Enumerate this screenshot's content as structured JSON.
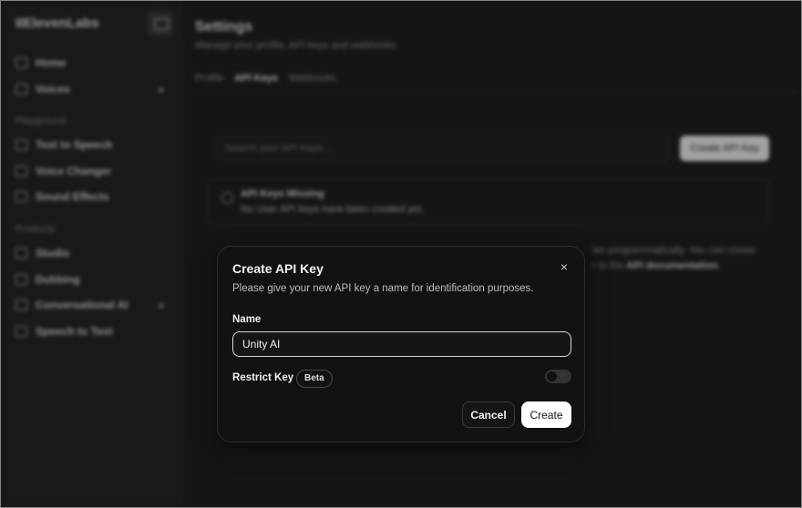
{
  "sidebar": {
    "logo": "IIElevenLabs",
    "items_top": [
      {
        "label": "Home",
        "icon": "home-icon"
      },
      {
        "label": "Voices",
        "icon": "voices-icon"
      }
    ],
    "section_playground": "Playground",
    "playground_items": [
      {
        "label": "Text to Speech",
        "icon": "text-to-speech-icon"
      },
      {
        "label": "Voice Changer",
        "icon": "voice-changer-icon"
      },
      {
        "label": "Sound Effects",
        "icon": "sound-effects-icon"
      }
    ],
    "section_products": "Products",
    "product_items": [
      {
        "label": "Studio",
        "icon": "studio-icon"
      },
      {
        "label": "Dubbing",
        "icon": "dubbing-icon"
      },
      {
        "label": "Conversational AI",
        "icon": "conversational-ai-icon"
      },
      {
        "label": "Speech to Text",
        "icon": "speech-to-text-icon"
      }
    ],
    "plus": "+"
  },
  "main": {
    "title": "Settings",
    "subtitle": "Manage your profile, API keys and webhooks.",
    "tabs": [
      {
        "label": "Profile",
        "active": false
      },
      {
        "label": "API Keys",
        "active": true
      },
      {
        "label": "Webhooks",
        "active": false
      }
    ],
    "search_placeholder": "Search your API Keys...",
    "create_button": "Create API Key",
    "empty_title": "API Keys Missing",
    "empty_desc": "No User API keys have been created yet.",
    "info_line1": "ies programmatically. You can create",
    "info_line2_prefix": "r to the",
    "info_link": "API documentation",
    "info_line2_suffix": "."
  },
  "modal": {
    "title": "Create API Key",
    "close": "×",
    "description": "Please give your new API key a name for identification purposes.",
    "name_label": "Name",
    "name_value": "Unity AI",
    "restrict_label": "Restrict Key",
    "beta_badge": "Beta",
    "restrict_enabled": false,
    "cancel_label": "Cancel",
    "create_label": "Create"
  }
}
